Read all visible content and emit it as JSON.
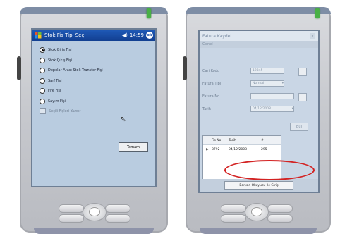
{
  "left_device": {
    "title_bar": {
      "title": "Stok Fis Tipi Seç",
      "volume": "◀)",
      "time": "14:59",
      "ok": "ok"
    },
    "options": [
      {
        "label": "Stok Giriş Fişi",
        "selected": true
      },
      {
        "label": "Stok Çıkış Fişi",
        "selected": false
      },
      {
        "label": "Depolar Arası Stok Transfer Fişi",
        "selected": false
      },
      {
        "label": "Sarf Fişi",
        "selected": false
      },
      {
        "label": "Fire Fişi",
        "selected": false
      },
      {
        "label": "Sayım Fişi",
        "selected": false
      }
    ],
    "checkbox_label": "Seçili Fişleri Yazdır",
    "ok_button": "Tamam"
  },
  "right_device": {
    "title": "Fatura Kaydet...",
    "close": "x",
    "tab": "Genel",
    "fields": [
      {
        "label": "Cari Kodu",
        "value": "12345"
      },
      {
        "label": "Fatura Tipi",
        "value": "Normal"
      },
      {
        "label": "Fatura No",
        "value": ""
      },
      {
        "label": "Tarih",
        "value": "04/12/2008"
      }
    ],
    "search_button": "Bul",
    "grid": {
      "headers": [
        "",
        "Fis No",
        "Tarih",
        "#"
      ],
      "rows": [
        [
          "▶",
          "8792",
          "04/12/2008",
          "295"
        ]
      ]
    },
    "bottom_button": "Barkod Okuyucu ile Giriş"
  }
}
